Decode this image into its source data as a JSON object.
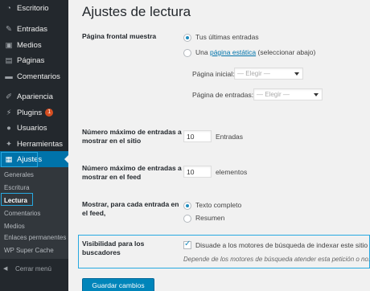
{
  "sidebar": {
    "items": [
      {
        "icon": "dashboard-icon",
        "glyph": "◔",
        "label": "Escritorio"
      },
      {
        "icon": "pin-icon",
        "glyph": "✎",
        "label": "Entradas"
      },
      {
        "icon": "media-icon",
        "glyph": "▣",
        "label": "Medios"
      },
      {
        "icon": "pages-icon",
        "glyph": "▤",
        "label": "Páginas"
      },
      {
        "icon": "comments-icon",
        "glyph": "▬",
        "label": "Comentarios"
      },
      {
        "icon": "appearance-icon",
        "glyph": "✐",
        "label": "Apariencia"
      },
      {
        "icon": "plugins-icon",
        "glyph": "⚡",
        "label": "Plugins",
        "badge": "1"
      },
      {
        "icon": "users-icon",
        "glyph": "●",
        "label": "Usuarios"
      },
      {
        "icon": "tools-icon",
        "glyph": "✦",
        "label": "Herramientas"
      },
      {
        "icon": "settings-icon",
        "glyph": "▦",
        "label": "Ajustes"
      }
    ],
    "submenu": [
      "Generales",
      "Escritura",
      "Lectura",
      "Comentarios",
      "Medios",
      "Enlaces permanentes",
      "WP Super Cache"
    ],
    "collapse_label": "Cerrar menú",
    "collapse_glyph": "◀"
  },
  "main": {
    "title": "Ajustes de lectura",
    "front_page": {
      "label": "Página frontal muestra",
      "option_latest": "Tus últimas entradas",
      "option_static_prefix": "Una ",
      "option_static_link": "página estática",
      "option_static_suffix": " (seleccionar abajo)",
      "home_label": "Página inicial:",
      "posts_label": "Página de entradas:",
      "select_placeholder": "— Elegir —"
    },
    "posts_per_page": {
      "label": "Número máximo de entradas a mostrar en el sitio",
      "value": "10",
      "unit": "Entradas"
    },
    "posts_per_feed": {
      "label": "Número máximo de entradas a mostrar en el feed",
      "value": "10",
      "unit": "elementos"
    },
    "feed_show": {
      "label": "Mostrar, para cada entrada en el feed,",
      "option_full": "Texto completo",
      "option_summary": "Resumen"
    },
    "visibility": {
      "label": "Visibilidad para los buscadores",
      "checkbox_label": "Disuade a los motores de búsqueda de indexar este sitio",
      "checked": true,
      "description": "Depende de los motores de búsqueda atender esta petición o no."
    },
    "save_label": "Guardar cambios"
  }
}
